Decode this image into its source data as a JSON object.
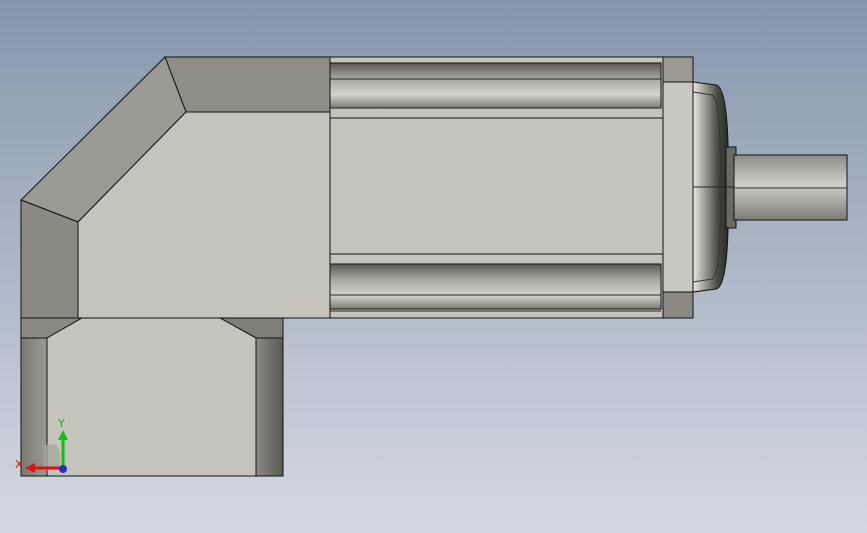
{
  "view": {
    "background_top": "#8796ad",
    "background_bottom": "#d4d8e2",
    "part_colors": {
      "face_light": "#c4c4bc",
      "face_mid": "#8e8e86",
      "face_dark": "#62625c",
      "edge": "#111111",
      "shaft": "#b8b8b0",
      "flange_dark": "#3a3a36"
    }
  },
  "triad": {
    "x_label": "X",
    "y_label": "Y",
    "x_color": "#e01010",
    "y_color": "#10c010",
    "origin_color": "#2030c0"
  }
}
